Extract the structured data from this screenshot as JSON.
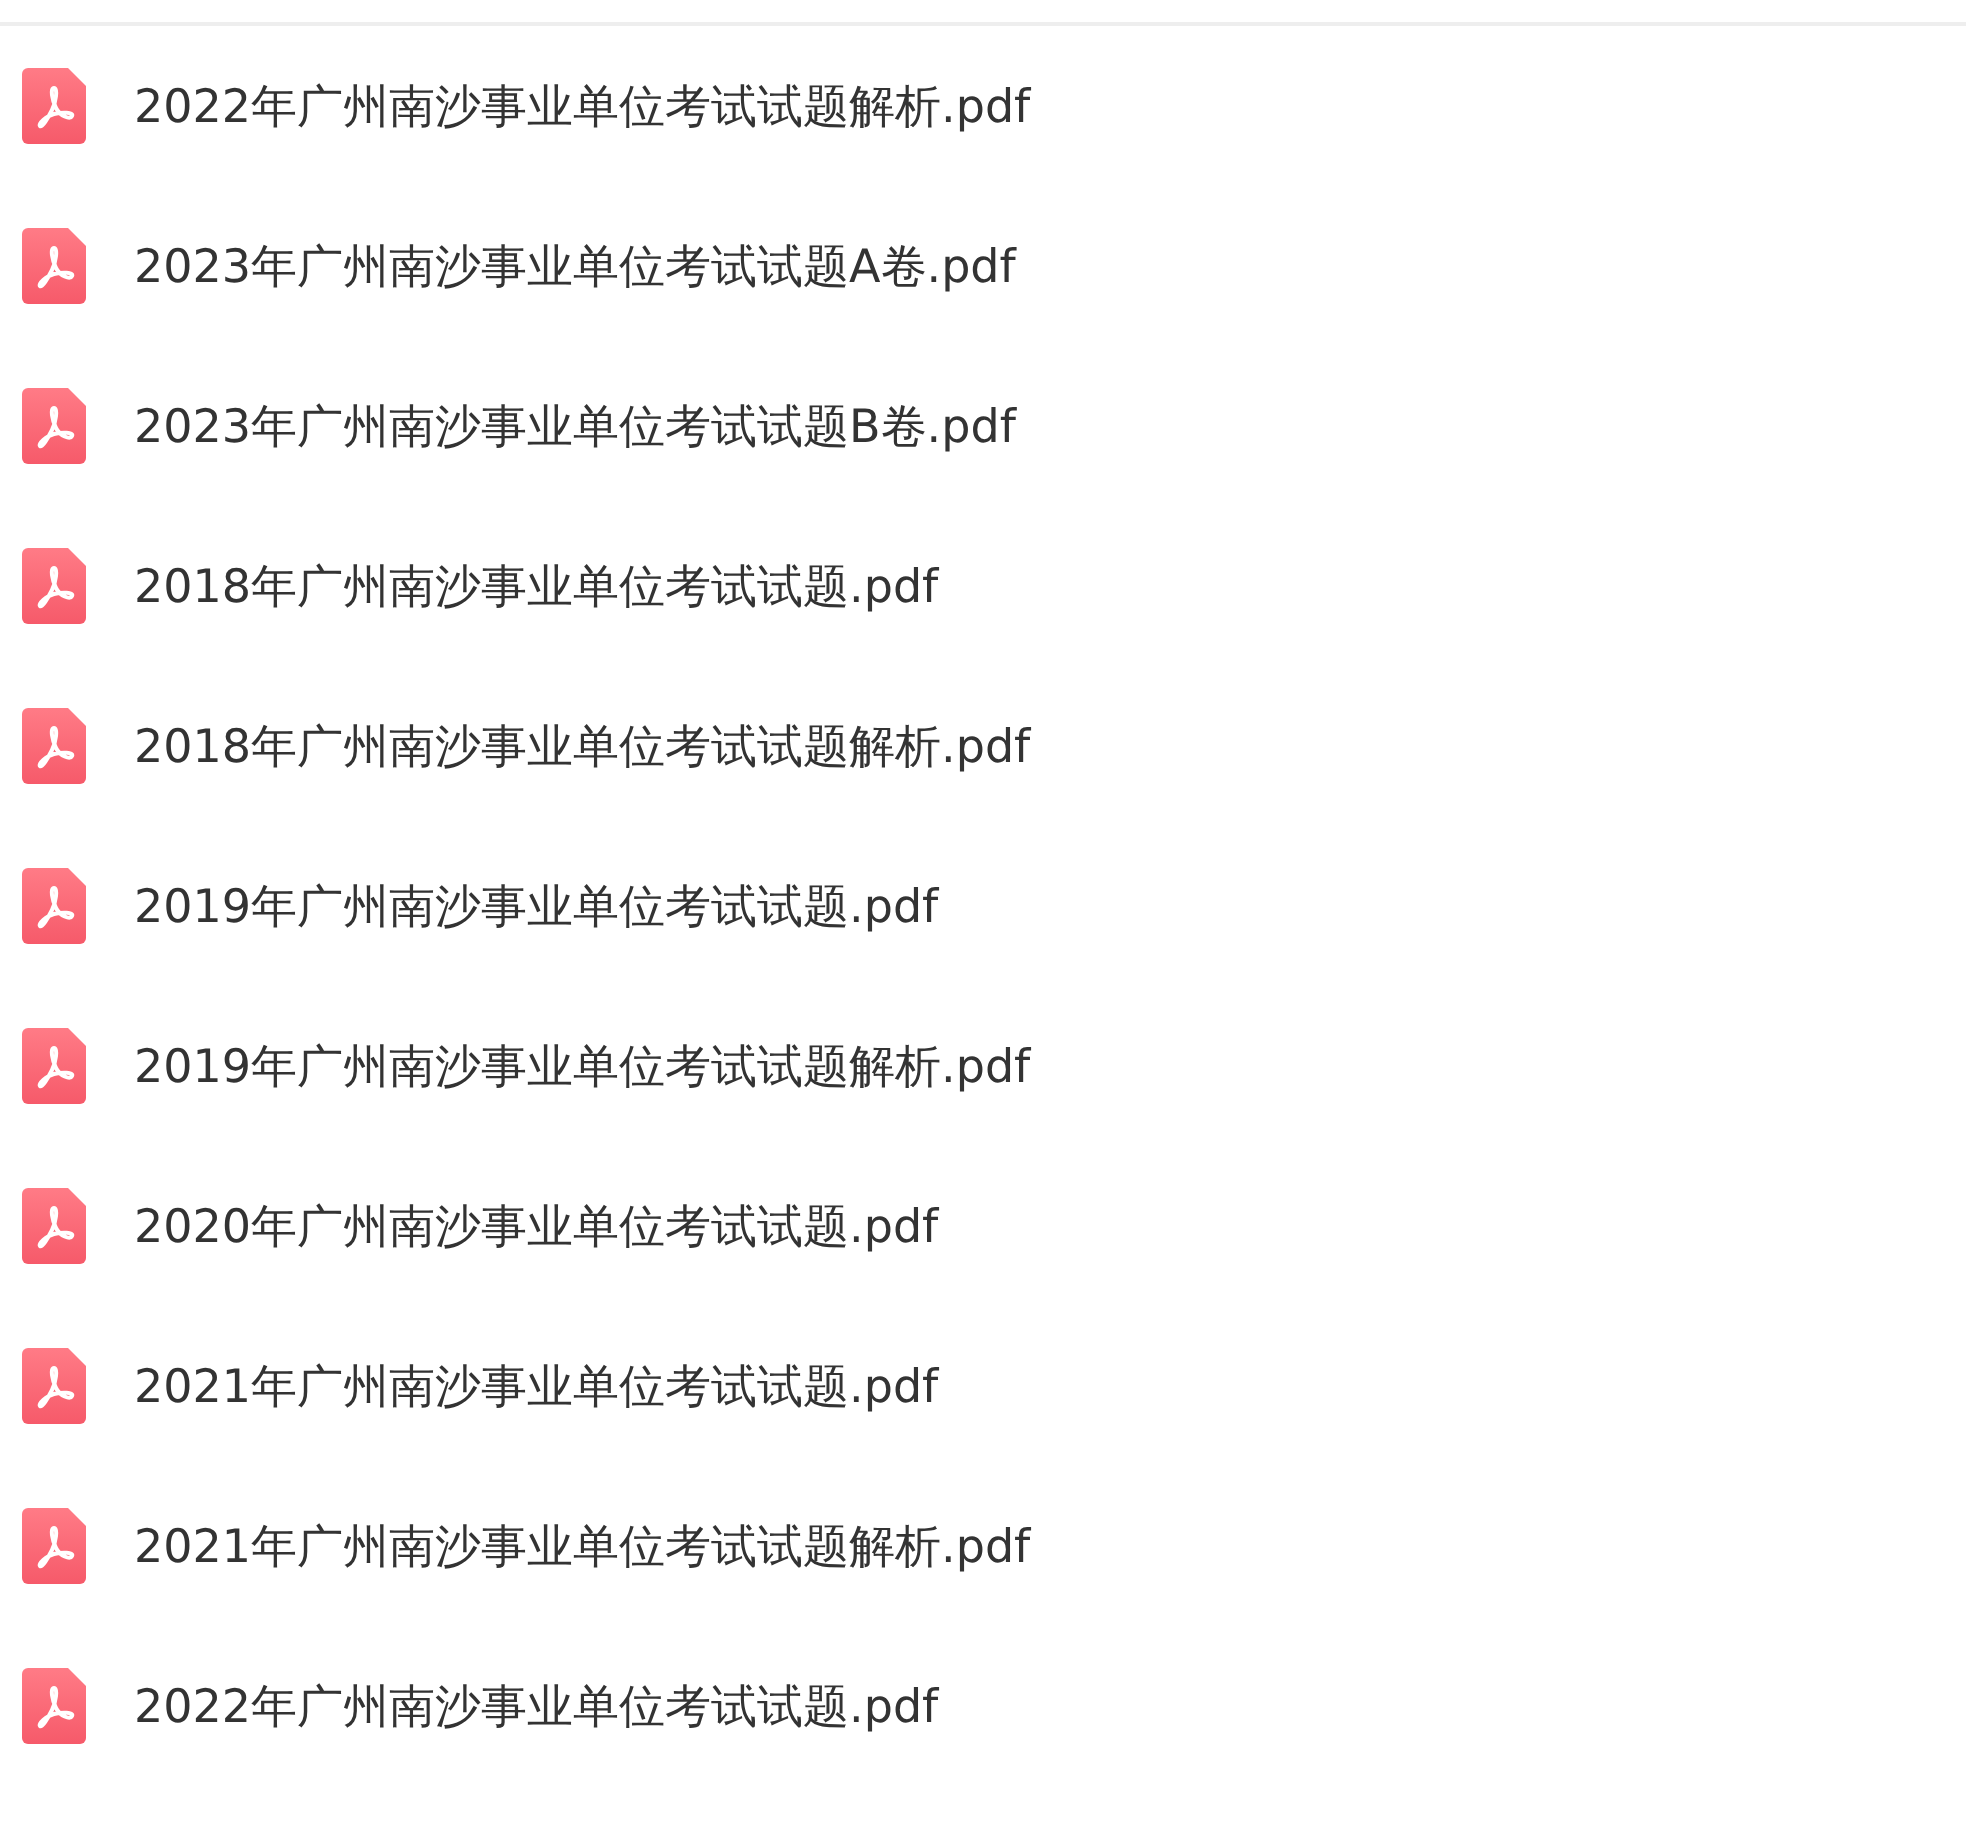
{
  "files": [
    {
      "name": "2022年广州南沙事业单位考试试题解析.pdf"
    },
    {
      "name": "2023年广州南沙事业单位考试试题A卷.pdf"
    },
    {
      "name": "2023年广州南沙事业单位考试试题B卷.pdf"
    },
    {
      "name": "2018年广州南沙事业单位考试试题.pdf"
    },
    {
      "name": "2018年广州南沙事业单位考试试题解析.pdf"
    },
    {
      "name": "2019年广州南沙事业单位考试试题.pdf"
    },
    {
      "name": "2019年广州南沙事业单位考试试题解析.pdf"
    },
    {
      "name": "2020年广州南沙事业单位考试试题.pdf"
    },
    {
      "name": "2021年广州南沙事业单位考试试题.pdf"
    },
    {
      "name": "2021年广州南沙事业单位考试试题解析.pdf"
    },
    {
      "name": "2022年广州南沙事业单位考试试题.pdf"
    }
  ]
}
